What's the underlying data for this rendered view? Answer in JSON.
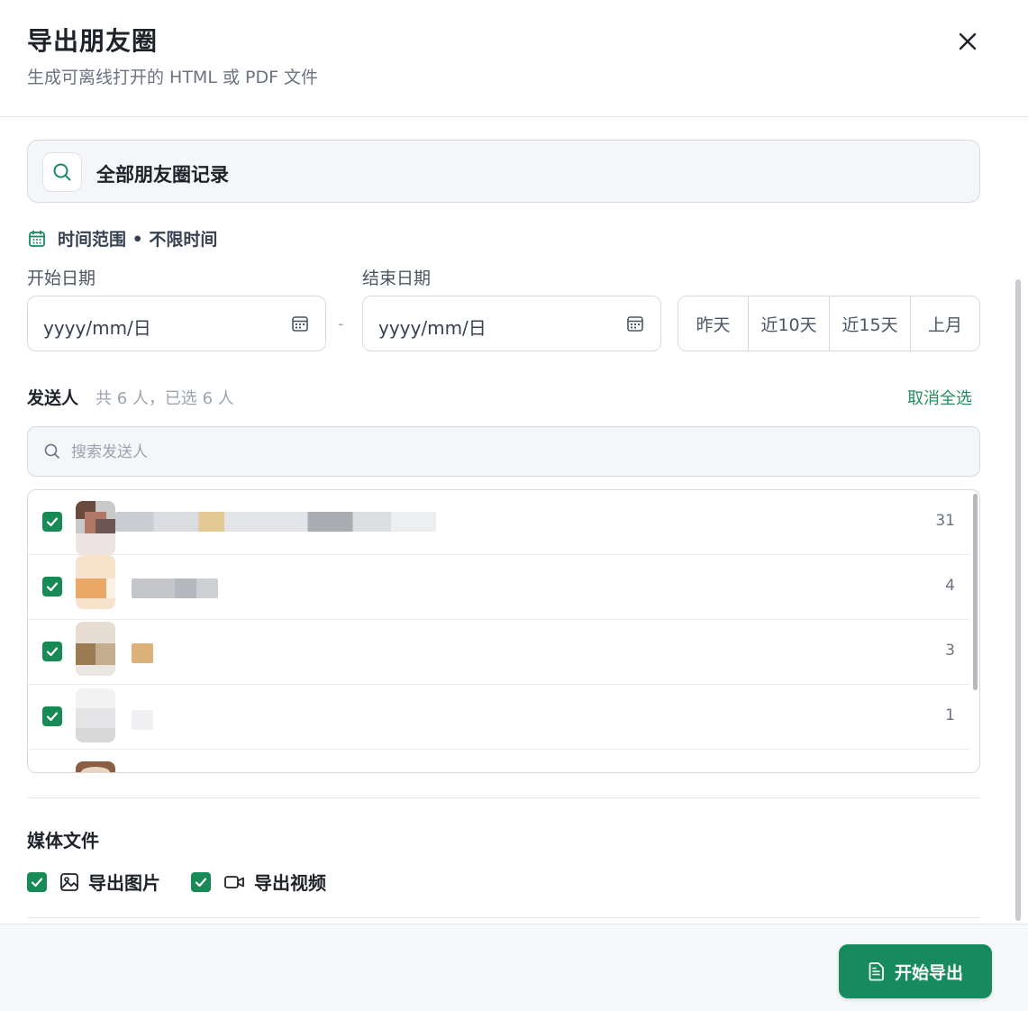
{
  "dialog": {
    "title": "导出朋友圈",
    "subtitle": "生成可离线打开的 HTML 或 PDF 文件"
  },
  "scope": {
    "label": "全部朋友圈记录"
  },
  "time_range": {
    "label": "时间范围 • 不限时间",
    "start_label": "开始日期",
    "end_label": "结束日期",
    "start_placeholder": "yyyy/mm/日",
    "end_placeholder": "yyyy/mm/日",
    "separator": "-",
    "quick": [
      "昨天",
      "近10天",
      "近15天",
      "上月"
    ]
  },
  "senders": {
    "title": "发送人",
    "count_text": "共 6 人，已选 6 人",
    "deselect_all": "取消全选",
    "search_placeholder": "搜索发送人",
    "rows": [
      {
        "count": "31",
        "checked": true
      },
      {
        "count": "4",
        "checked": true
      },
      {
        "count": "3",
        "checked": true
      },
      {
        "count": "1",
        "checked": true
      }
    ]
  },
  "media": {
    "title": "媒体文件",
    "export_images": "导出图片",
    "export_videos": "导出视频",
    "images_checked": true,
    "videos_checked": true
  },
  "footer": {
    "export_button": "开始导出"
  },
  "colors": {
    "accent": "#178a5f",
    "link": "#1e8f5e"
  },
  "icons": {
    "close": "close-icon",
    "search": "search-icon",
    "calendar": "calendar-icon",
    "checkbox": "check-icon",
    "image": "image-icon",
    "video": "video-icon",
    "document": "document-icon"
  }
}
